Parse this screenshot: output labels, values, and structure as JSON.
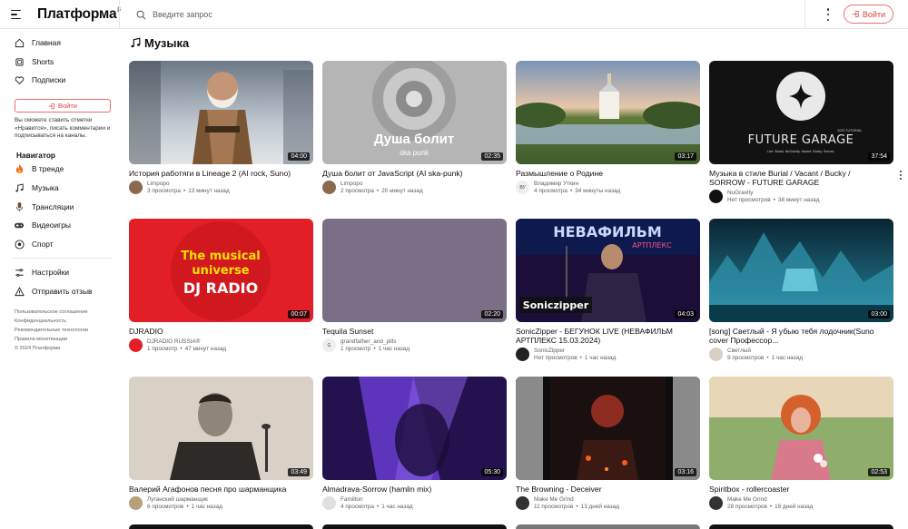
{
  "header": {
    "logo": "Платформа",
    "logo_sup": "β",
    "search_placeholder": "Введите запрос",
    "login_label": "Войти"
  },
  "sidebar": {
    "items": [
      {
        "label": "Главная",
        "icon": "home-icon"
      },
      {
        "label": "Shorts",
        "icon": "shorts-icon"
      },
      {
        "label": "Подписки",
        "icon": "heart-icon"
      }
    ],
    "login_label": "Войти",
    "note": "Вы сможете ставить отметки «Нравится», писать комментарии и подписываться на каналы.",
    "navigator_title": "Навигатор",
    "navigator": [
      {
        "label": "В тренде",
        "icon": "fire-icon"
      },
      {
        "label": "Музыка",
        "icon": "music-icon"
      },
      {
        "label": "Трансляции",
        "icon": "broadcast-icon"
      },
      {
        "label": "Видеоигры",
        "icon": "gamepad-icon"
      },
      {
        "label": "Спорт",
        "icon": "ball-icon"
      }
    ],
    "settings": [
      {
        "label": "Настройки",
        "icon": "settings-icon"
      },
      {
        "label": "Отправить отзыв",
        "icon": "feedback-icon"
      }
    ],
    "footer_links": [
      "Пользовательское соглашение",
      "Конфиденциальность",
      "Рекомендательные технологии",
      "Правила монетизации"
    ],
    "copyright": "© 2024 Платформа"
  },
  "main": {
    "section_title": "Музыка",
    "section_icon": "music-note-icon",
    "videos": [
      {
        "title": "История работяги в Lineage 2 (AI rock, Suno)",
        "channel": "Limpopo",
        "views": "3 просмотра",
        "time": "13 минут назад",
        "duration": "04:00"
      },
      {
        "title": "Душа болит от JavaScript (AI ska-punk)",
        "channel": "Limpopo",
        "views": "2 просмотра",
        "time": "20 минут назад",
        "duration": "02:35",
        "thumb_text": "Душа болит",
        "thumb_sub": "ska punk"
      },
      {
        "title": "Размышление о Родине",
        "channel": "Владимир Уткин",
        "views": "4 просмотра",
        "time": "34 минуты назад",
        "duration": "03:17",
        "avatar_text": "ВУ"
      },
      {
        "title": "Музыка в стиле Burial / Vacant / Bucky / SORROW - FUTURE GARAGE",
        "channel": "NuGravity",
        "views": "Нет просмотров",
        "time": "38 минут назад",
        "duration": "37:54",
        "thumb_text": "FUTURE GARAGE",
        "thumb_sub": "Live. Burial. NuGravity. Vacant. Bucky. Sorrow.",
        "thumb_tag": "2023 TUTORIAL"
      },
      {
        "title": "DJRADIO",
        "channel": "DJRADIO RUSSIA®",
        "views": "1 просмотр",
        "time": "47 минут назад",
        "duration": "00:07",
        "thumb_text": "The musical universe",
        "thumb_sub": "DJ RADIO"
      },
      {
        "title": "Tequila Sunset",
        "channel": "grandfather_and_pills",
        "views": "1 просмотр",
        "time": "1 час назад",
        "duration": "02:20",
        "avatar_text": "G"
      },
      {
        "title": "SonicZipper - БЕГУНОК LIVE (НЕВАФИЛЬМ АРТПЛЕКС 15.03.2024)",
        "channel": "SonicZipper",
        "views": "Нет просмотров",
        "time": "1 час назад",
        "duration": "04:03",
        "thumb_text": "НЕВАФИЛЬМ",
        "thumb_sub": "АРТПЛЕКС",
        "thumb_tag": "Soniczipper"
      },
      {
        "title": "[song] Светлый - Я убыю тебя лодочник(Suno cover Профессор...",
        "channel": "Светлый",
        "views": "9 просмотров",
        "time": "1 час назад",
        "duration": "03:00"
      },
      {
        "title": "Валерий Агафонов песня про шарманщика",
        "channel": "Луганский шарманщик",
        "views": "6 просмотров",
        "time": "1 час назад",
        "duration": "03:49"
      },
      {
        "title": "Almadrava-Sorrow (hamlin mix)",
        "channel": "Familton",
        "views": "4 просмотра",
        "time": "1 час назад",
        "duration": "05:30"
      },
      {
        "title": "The Browning - Deceiver",
        "channel": "Make Me Grind",
        "views": "11 просмотров",
        "time": "13 дней назад",
        "duration": "03:16"
      },
      {
        "title": "Spiritbox - rollercoaster",
        "channel": "Make Me Grind",
        "views": "28 просмотров",
        "time": "16 дней назад",
        "duration": "02:53"
      }
    ]
  },
  "colors": {
    "accent": "#e0453b",
    "text": "#0f0f0f",
    "muted": "#606060"
  }
}
